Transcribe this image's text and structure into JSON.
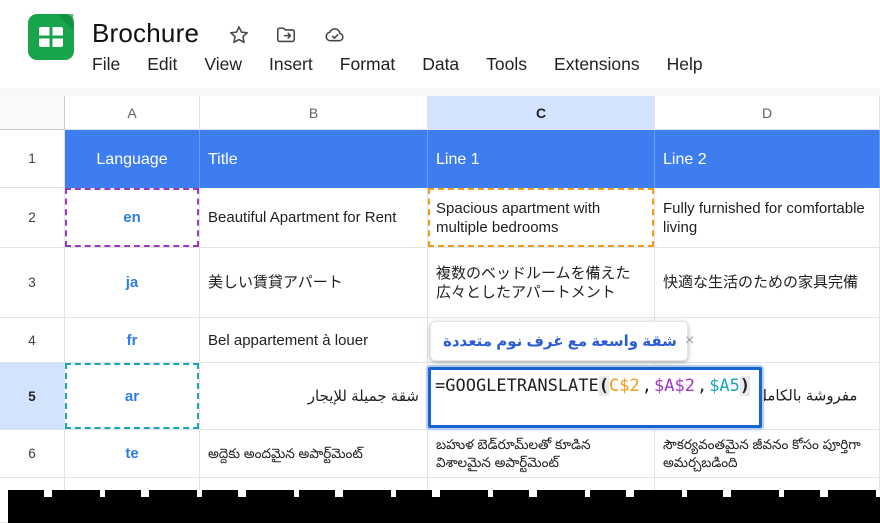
{
  "app": {
    "title": "Brochure",
    "menu": [
      "File",
      "Edit",
      "View",
      "Insert",
      "Format",
      "Data",
      "Tools",
      "Extensions",
      "Help"
    ],
    "titlebar_icons": [
      "star-icon",
      "move-folder-icon",
      "cloud-saved-icon"
    ]
  },
  "grid": {
    "column_headers": [
      "A",
      "B",
      "C",
      "D"
    ],
    "selected_column": "C",
    "row_numbers": [
      "1",
      "2",
      "3",
      "4",
      "5",
      "6"
    ],
    "selected_row": "5"
  },
  "table": {
    "header": {
      "language": "Language",
      "title": "Title",
      "line1": "Line 1",
      "line2": "Line 2"
    },
    "r2": {
      "lang": "en",
      "title": "Beautiful Apartment for Rent",
      "line1": "Spacious apartment with multiple bedrooms",
      "line2": "Fully furnished for comfortable living"
    },
    "r3": {
      "lang": "ja",
      "title": "美しい賃貸アパート",
      "line1": "複数のベッドルームを備えた広々としたアパートメント",
      "line2": "快適な生活のための家具完備"
    },
    "r4": {
      "lang": "fr",
      "title": "Bel appartement à louer"
    },
    "r5": {
      "lang": "ar",
      "title": "شقة جميلة للإيجار",
      "line2": "مفروشة بالكامل لمعيشة مريحة"
    },
    "r6": {
      "lang": "te",
      "title": "అద్దెకు అందమైన అపార్ట్‌మెంట్",
      "line1": "బహుళ బెడ్‌రూమ్‌లతో కూడిన విశాలమైన అపార్ట్‌మెంట్",
      "line2": "సౌకర్యవంతమైన జీవనం కోసం పూర్తిగా అమర్చబడింది"
    }
  },
  "formula": {
    "tokens": [
      {
        "text": "=GOOGLETRANSLATE",
        "color": "#1f1f1f"
      },
      {
        "text": "(",
        "color": "#1f1f1f"
      },
      {
        "text": "C$2",
        "color": "#f29b13"
      },
      {
        "text": ",",
        "color": "#1f1f1f"
      },
      {
        "text": "$A$2",
        "color": "#a138c8"
      },
      {
        "text": ",",
        "color": "#1f1f1f"
      },
      {
        "text": "$A5",
        "color": "#15a6b8"
      },
      {
        "text": ")",
        "color": "#1f1f1f"
      }
    ],
    "preview": {
      "text": "شقة واسعة مع غرف نوم متعددة",
      "text_color": "#2b5dd7",
      "close": "×"
    }
  },
  "colors": {
    "header_fill": "#3d7df0",
    "selected_header_bg": "#d3e3fd",
    "language_link_blue": "#2f7ce9",
    "ref_orange": "#f29b13",
    "ref_purple": "#9c36c6",
    "ref_teal": "#17a7b5",
    "formula_border_blue": "#1763d2",
    "logo_green": "#17a44b"
  }
}
